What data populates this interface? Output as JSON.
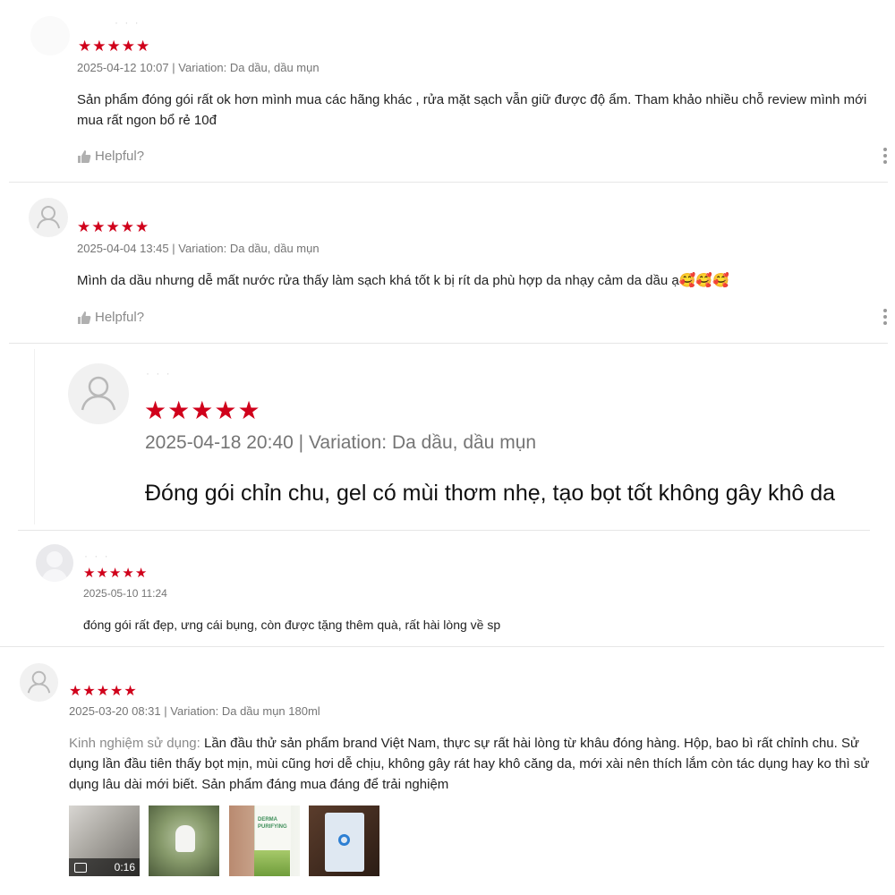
{
  "reviews": [
    {
      "rating": 5,
      "date": "2025-04-12 10:07",
      "variation": "| Variation: Da dầu, dầu mụn",
      "text": "Sản phẩm đóng gói rất ok hơn mình mua các hãng khác , rửa mặt sạch vẫn giữ được độ ẩm. Tham khảo nhiều chỗ review mình mới mua rất ngon bổ rẻ 10đ",
      "helpful_label": "Helpful?"
    },
    {
      "rating": 5,
      "date": "2025-04-04 13:45",
      "variation": "| Variation: Da dầu, dầu mụn",
      "text": "Mình da dầu nhưng dễ mất nước rửa thấy làm sạch khá tốt k bị rít da phù hợp da nhạy cảm da dầu ạ🥰🥰🥰",
      "helpful_label": "Helpful?"
    },
    {
      "rating": 5,
      "date": "2025-04-18 20:40",
      "variation": "| Variation: Da dầu, dầu mụn",
      "text": "Đóng gói chỉn chu, gel có mùi thơm nhẹ, tạo bọt tốt không gây khô da"
    },
    {
      "rating": 5,
      "date": "2025-05-10 11:24",
      "text": "đóng gói rất đẹp, ưng cái bụng, còn được tặng thêm quà, rất hài lòng về sp"
    },
    {
      "rating": 5,
      "date": "2025-03-20 08:31",
      "variation": "| Variation: Da dầu mụn 180ml",
      "text_label": "Kinh nghiệm sử dụng:",
      "text": "Lần đầu thử sản phẩm brand Việt Nam, thực sự rất hài lòng từ khâu đóng hàng. Hộp, bao bì rất chỉnh chu. Sử dụng lần đầu tiên thấy bọt mịn, mùi cũng hơi dễ chịu, không gây rát hay khô căng da, mới xài nên thích lắm còn tác dụng hay ko thì sử dụng lâu dài mới biết. Sản phẩm đáng mua đáng để trải nghiệm",
      "media": {
        "video_duration": "0:16",
        "photo_text": "DERMA PURIFYING"
      }
    }
  ],
  "colors": {
    "star": "#d0011b",
    "meta": "#757575",
    "separator": "#e6e6e6"
  },
  "icons": {
    "star": "star-icon",
    "helpful": "thumb-up-icon",
    "more": "more-vertical-icon",
    "avatar": "user-avatar-icon",
    "video": "video-camera-icon"
  }
}
